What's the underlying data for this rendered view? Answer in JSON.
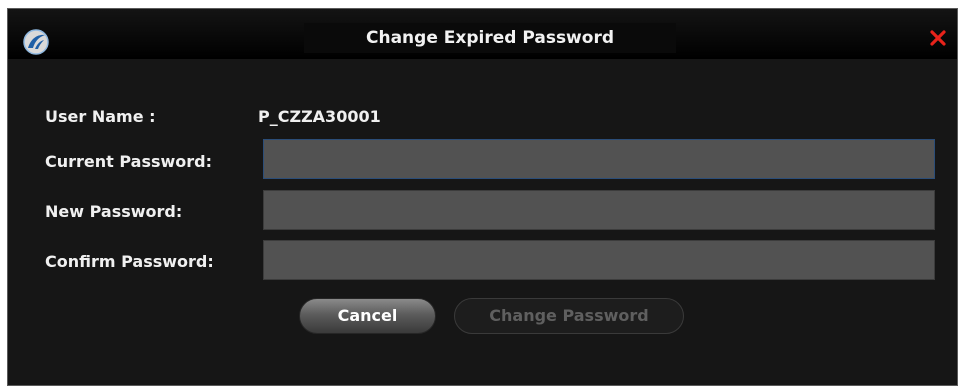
{
  "window": {
    "title": "Change Expired Password",
    "logo_icon": "app-logo-icon",
    "close_icon": "close-icon",
    "close_color": "#e8231b"
  },
  "form": {
    "user_name_label": "User Name :",
    "user_name_value": "P_CZZA30001",
    "current_password_label": "Current Password:",
    "current_password_value": "",
    "new_password_label": "New Password:",
    "new_password_value": "",
    "confirm_password_label": "Confirm Password:",
    "confirm_password_value": ""
  },
  "buttons": {
    "cancel_label": "Cancel",
    "change_password_label": "Change Password",
    "change_password_enabled": false
  }
}
